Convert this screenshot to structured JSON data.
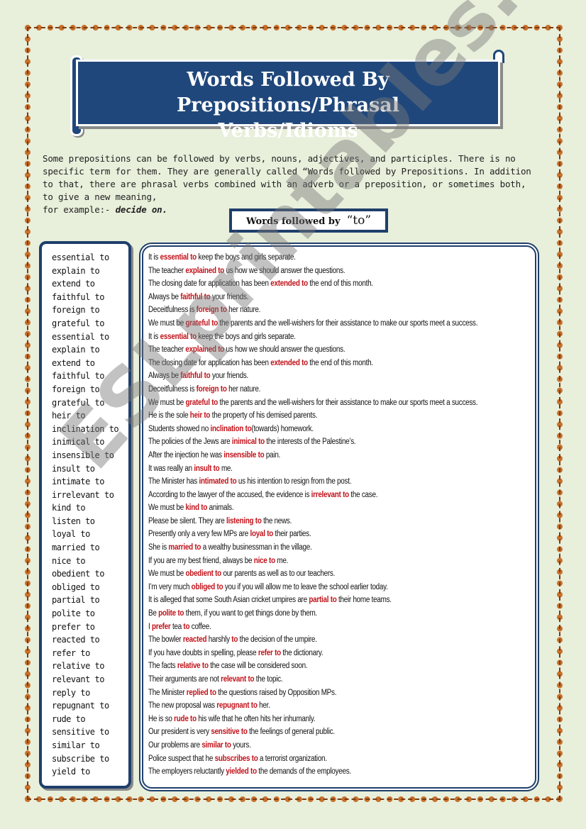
{
  "title": "Words Followed By Prepositions/Phrasal Verbs/Idioms",
  "title_lines": [
    "Words Followed By Prepositions/Phrasal",
    "Verbs/Idioms"
  ],
  "intro": {
    "text": "Some prepositions can be followed by verbs, nouns, adjectives, and participles. There is no specific term for them. They are generally called “Words followed by Prepositions. In addition to that, there are phrasal verbs combined with an adverb or a preposition, or sometimes both, to give a new meaning,",
    "example_prefix": "for example:- ",
    "example": "decide on."
  },
  "subtitle": {
    "text": "Words followed by",
    "quoted": "“to”"
  },
  "colors": {
    "navy": "#1f477b",
    "highlight": "#c0131b",
    "background": "#e8efdb",
    "border_ornament": "#c8702a"
  },
  "watermark": "ESLprintables.com",
  "entries": [
    {
      "word": "essential to",
      "pre": "It is ",
      "hl": "essential to",
      "post": " keep the boys and girls separate."
    },
    {
      "word": "explain to",
      "pre": "The teacher ",
      "hl": "explained to",
      "post": " us how we should answer the questions."
    },
    {
      "word": "extend to",
      "pre": "The closing date for application has been ",
      "hl": "extended to",
      "post": " the end of this month."
    },
    {
      "word": "faithful to",
      "pre": "Always be ",
      "hl": "faithful to",
      "post": " your friends."
    },
    {
      "word": "foreign to",
      "pre": "Deceitfulness is ",
      "hl": "foreign to",
      "post": " her nature."
    },
    {
      "word": "grateful to",
      "pre": "We must be ",
      "hl": "grateful to",
      "post": " the parents and the well-wishers for their assistance to make our sports meet a success."
    },
    {
      "word": "essential to",
      "pre": "It is ",
      "hl": "essential to",
      "post": " keep the boys and girls separate."
    },
    {
      "word": "explain to",
      "pre": "The teacher ",
      "hl": "explained to",
      "post": " us how we should answer the questions."
    },
    {
      "word": "extend to",
      "pre": "The closing date for application has been ",
      "hl": "extended to",
      "post": " the end of this month."
    },
    {
      "word": "faithful to",
      "pre": "Always be ",
      "hl": "faithful to",
      "post": " your friends."
    },
    {
      "word": "foreign to",
      "pre": "Deceitfulness is ",
      "hl": "foreign to",
      "post": " her nature."
    },
    {
      "word": "grateful to",
      "pre": "We must be ",
      "hl": "grateful to",
      "post": " the parents and the well-wishers for their assistance to make our sports meet a success."
    },
    {
      "word": "heir to",
      "pre": "He is the sole ",
      "hl": "heir to",
      "post": " the property of his demised parents."
    },
    {
      "word": "inclination to",
      "pre": "Students showed no ",
      "hl": "inclination to",
      "post": "(towards) homework."
    },
    {
      "word": "inimical to",
      "pre": "The policies of the Jews are ",
      "hl": "inimical to",
      "post": " the interests of the Palestine’s."
    },
    {
      "word": "insensible to",
      "pre": "After the injection he was ",
      "hl": "insensible to",
      "post": " pain."
    },
    {
      "word": "insult to",
      "pre": "It was really an ",
      "hl": "insult to",
      "post": " me."
    },
    {
      "word": "intimate to",
      "pre": "The Minister has ",
      "hl": "intimated to",
      "post": " us his intention to resign from the post."
    },
    {
      "word": "irrelevant to",
      "pre": "According to the lawyer of the accused, the evidence is ",
      "hl": "irrelevant to",
      "post": " the case."
    },
    {
      "word": "kind to",
      "pre": "We must be ",
      "hl": "kind to",
      "post": " animals."
    },
    {
      "word": "listen to",
      "pre": "Please be silent. They are ",
      "hl": "listening to",
      "post": " the news."
    },
    {
      "word": "loyal to",
      "pre": "Presently only a very few MPs are ",
      "hl": "loyal to",
      "post": " their parties."
    },
    {
      "word": "married to",
      "pre": "She is ",
      "hl": "married to",
      "post": " a wealthy businessman in the village."
    },
    {
      "word": "nice to",
      "pre": "If you are my best friend, always be ",
      "hl": "nice to",
      "post": " me."
    },
    {
      "word": "obedient to",
      "pre": "We must be ",
      "hl": "obedient to",
      "post": " our parents as well as to our teachers."
    },
    {
      "word": "obliged to",
      "pre": "I’m very much ",
      "hl": "obliged to",
      "post": " you if you will allow me to leave the school earlier today."
    },
    {
      "word": "partial to",
      "pre": "It is alleged that some South Asian cricket umpires are ",
      "hl": "partial to",
      "post": " their home teams."
    },
    {
      "word": "polite to",
      "pre": "Be ",
      "hl": "polite to",
      "post": " them,  if you want to get things done by them."
    },
    {
      "word": "prefer to",
      "pre": "I ",
      "hl": "prefer",
      "mid": " tea ",
      "hl2": "to",
      "post": " coffee."
    },
    {
      "word": "reacted to",
      "pre": "The bowler ",
      "hl": "reacted",
      "mid": " harshly ",
      "hl2": "to",
      "post": " the decision of the umpire."
    },
    {
      "word": "refer to",
      "pre": "If you have doubts in spelling,  please ",
      "hl": "refer to",
      "post": " the dictionary."
    },
    {
      "word": "relative to",
      "pre": "The facts ",
      "hl": "relative to",
      "post": " the case will be considered soon."
    },
    {
      "word": "relevant to",
      "pre": "Their arguments are not ",
      "hl": "relevant to",
      "post": " the topic."
    },
    {
      "word": "reply to",
      "pre": "The Minister ",
      "hl": "replied to",
      "post": " the questions raised by Opposition MPs."
    },
    {
      "word": "repugnant to",
      "pre": "The new proposal was ",
      "hl": "repugnant to",
      "post": " her."
    },
    {
      "word": "rude to",
      "pre": "He is so ",
      "hl": "rude to",
      "post": " his wife that he often hits her inhumanly."
    },
    {
      "word": "sensitive to",
      "pre": "Our president is very ",
      "hl": "sensitive to",
      "post": " the feelings of general public."
    },
    {
      "word": "similar to",
      "pre": "Our problems are  ",
      "hl": "similar to",
      "post": " yours."
    },
    {
      "word": "subscribe to",
      "pre": "Police suspect that he ",
      "hl": "subscribes to",
      "post": " a terrorist organization."
    },
    {
      "word": "yield to",
      "pre": "The employers reluctantly ",
      "hl": "yielded to",
      "post": " the demands of the employees."
    }
  ]
}
